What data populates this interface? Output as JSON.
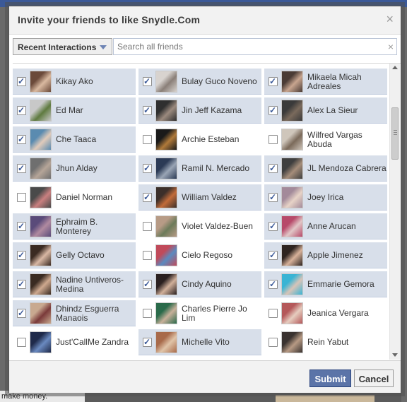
{
  "dialog": {
    "title": "Invite your friends to like Snydle.Com",
    "close_glyph": "×"
  },
  "filter": {
    "label": "Recent Interactions",
    "search_placeholder": "Search all friends",
    "clear_glyph": "×"
  },
  "friends": [
    {
      "name": "Kikay Ako",
      "selected": true,
      "avatar_colors": [
        "#6b4a3a",
        "#d9b9a0"
      ]
    },
    {
      "name": "Bulay Guco Noveno",
      "selected": true,
      "avatar_colors": [
        "#d8d3cf",
        "#8a7f78"
      ]
    },
    {
      "name": "Mikaela Micah Adreales",
      "selected": true,
      "avatar_colors": [
        "#4a3b35",
        "#c8a58f"
      ]
    },
    {
      "name": "Ed Mar",
      "selected": true,
      "avatar_colors": [
        "#c8c8c8",
        "#5e7a3f"
      ]
    },
    {
      "name": "Jin Jeff Kazama",
      "selected": true,
      "avatar_colors": [
        "#2f2f2f",
        "#9b8a7e"
      ]
    },
    {
      "name": "Alex La Sieur",
      "selected": true,
      "avatar_colors": [
        "#3a3a3a",
        "#7a6a5c"
      ]
    },
    {
      "name": "Che Taaca",
      "selected": true,
      "avatar_colors": [
        "#5a8bb0",
        "#e0cbbb"
      ]
    },
    {
      "name": "Archie Esteban",
      "selected": false,
      "avatar_colors": [
        "#1a1a1a",
        "#b07a3a"
      ]
    },
    {
      "name": "Wilfred Vargas Abuda",
      "selected": false,
      "avatar_colors": [
        "#cfc6bb",
        "#7b6a5a"
      ]
    },
    {
      "name": "Jhun Alday",
      "selected": true,
      "avatar_colors": [
        "#6f6f6f",
        "#b5a598"
      ]
    },
    {
      "name": "Ramil N. Mercado",
      "selected": true,
      "avatar_colors": [
        "#2b3a55",
        "#9aa5b5"
      ]
    },
    {
      "name": "JL Mendoza Cabrera",
      "selected": true,
      "avatar_colors": [
        "#3f3f3f",
        "#a58d7a"
      ]
    },
    {
      "name": "Daniel Norman",
      "selected": false,
      "avatar_colors": [
        "#4a4a4a",
        "#c98080"
      ]
    },
    {
      "name": "William Valdez",
      "selected": true,
      "avatar_colors": [
        "#3b2f2a",
        "#c26b3a"
      ]
    },
    {
      "name": "Joey Irica",
      "selected": true,
      "avatar_colors": [
        "#a38a9a",
        "#e7d3c7"
      ]
    },
    {
      "name": "Ephraim B. Monterey",
      "selected": true,
      "avatar_colors": [
        "#5a4b7a",
        "#b08aa0"
      ]
    },
    {
      "name": "Violet Valdez-Buen",
      "selected": false,
      "avatar_colors": [
        "#b79b86",
        "#6c7b5a"
      ]
    },
    {
      "name": "Anne Arucan",
      "selected": true,
      "avatar_colors": [
        "#b74a6a",
        "#e1c7c7"
      ]
    },
    {
      "name": "Gelly Octavo",
      "selected": true,
      "avatar_colors": [
        "#3a2a22",
        "#d9b8a4"
      ]
    },
    {
      "name": "Cielo Regoso",
      "selected": false,
      "avatar_colors": [
        "#c04a5a",
        "#5a8ac0"
      ]
    },
    {
      "name": "Apple Jimenez",
      "selected": true,
      "avatar_colors": [
        "#2e2420",
        "#d8b29a"
      ]
    },
    {
      "name": "Nadine Untiveros-Medina",
      "selected": true,
      "avatar_colors": [
        "#3a2b22",
        "#cfa98f"
      ]
    },
    {
      "name": "Cindy Aquino",
      "selected": true,
      "avatar_colors": [
        "#2a2020",
        "#d1b09a"
      ]
    },
    {
      "name": "Emmarie Gemora",
      "selected": true,
      "avatar_colors": [
        "#3ab4d4",
        "#d8c4b8"
      ]
    },
    {
      "name": "Dhindz Esguerra Manaois",
      "selected": true,
      "avatar_colors": [
        "#c8a990",
        "#7a3a3a"
      ]
    },
    {
      "name": "Charles Pierre Jo Lim",
      "selected": false,
      "avatar_colors": [
        "#2a6a4a",
        "#c8b09a"
      ]
    },
    {
      "name": "Jeanica Vergara",
      "selected": false,
      "avatar_colors": [
        "#b4585a",
        "#e6cdbf"
      ]
    },
    {
      "name": "Just'CallMe Zandra",
      "selected": false,
      "avatar_colors": [
        "#1f2a4a",
        "#6a8ac0"
      ]
    },
    {
      "name": "Michelle Vito",
      "selected": true,
      "avatar_colors": [
        "#a86a4a",
        "#e0c4a8"
      ]
    },
    {
      "name": "Rein Yabut",
      "selected": false,
      "avatar_colors": [
        "#3a3330",
        "#b79a84"
      ]
    },
    {
      "name": "",
      "selected": false,
      "avatar_colors": [
        "#c85a3a",
        "#e0c0a0"
      ]
    },
    {
      "name": "",
      "selected": false,
      "avatar_colors": [
        "#8a6a5a",
        "#d0b8a0"
      ]
    },
    {
      "name": "",
      "selected": false,
      "avatar_colors": [
        "#4a4a4a",
        "#c0b0a0"
      ]
    }
  ],
  "buttons": {
    "submit": "Submit",
    "cancel": "Cancel"
  },
  "background": {
    "bottom_text": "make money."
  },
  "colors": {
    "selected_row": "#d8dfea",
    "submit_bg": "#5b74a8",
    "header_bg": "#f2f2f2",
    "facebook_blue": "#3b5998"
  }
}
